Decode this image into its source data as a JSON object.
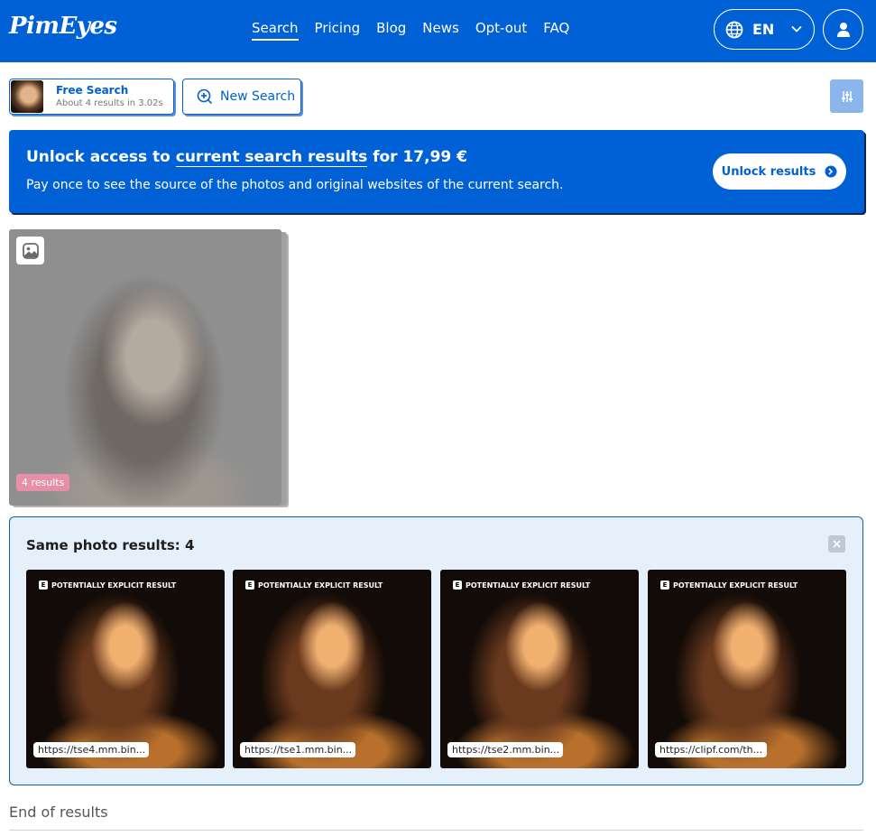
{
  "header": {
    "logo": "PimEyes",
    "nav": [
      "Search",
      "Pricing",
      "Blog",
      "News",
      "Opt-out",
      "FAQ"
    ],
    "active_nav": "Search",
    "language": "EN"
  },
  "search": {
    "free_label": "Free Search",
    "free_meta": "About 4 results in 3.02s",
    "new_label": "New Search"
  },
  "banner": {
    "pre": "Unlock access to ",
    "link": "current search results",
    "post": " for 17,99 €",
    "description": "Pay once to see the source of the photos and original websites of the current search.",
    "button": "Unlock results"
  },
  "result_card": {
    "count": "4 results"
  },
  "same_photo": {
    "title": "Same photo results: 4",
    "tiles": [
      {
        "tag": "POTENTIALLY EXPLICIT RESULT",
        "badge": "E",
        "url": "https://tse4.mm.bin..."
      },
      {
        "tag": "POTENTIALLY EXPLICIT RESULT",
        "badge": "E",
        "url": "https://tse1.mm.bin..."
      },
      {
        "tag": "POTENTIALLY EXPLICIT RESULT",
        "badge": "E",
        "url": "https://tse2.mm.bin..."
      },
      {
        "tag": "POTENTIALLY EXPLICIT RESULT",
        "badge": "E",
        "url": "https://clipf.com/th..."
      }
    ]
  },
  "footer": {
    "end_text": "End of results"
  },
  "colors": {
    "brand_blue": "#0060d6",
    "panel_bg": "#e6f0fb",
    "count_badge": "#e58fa9"
  }
}
